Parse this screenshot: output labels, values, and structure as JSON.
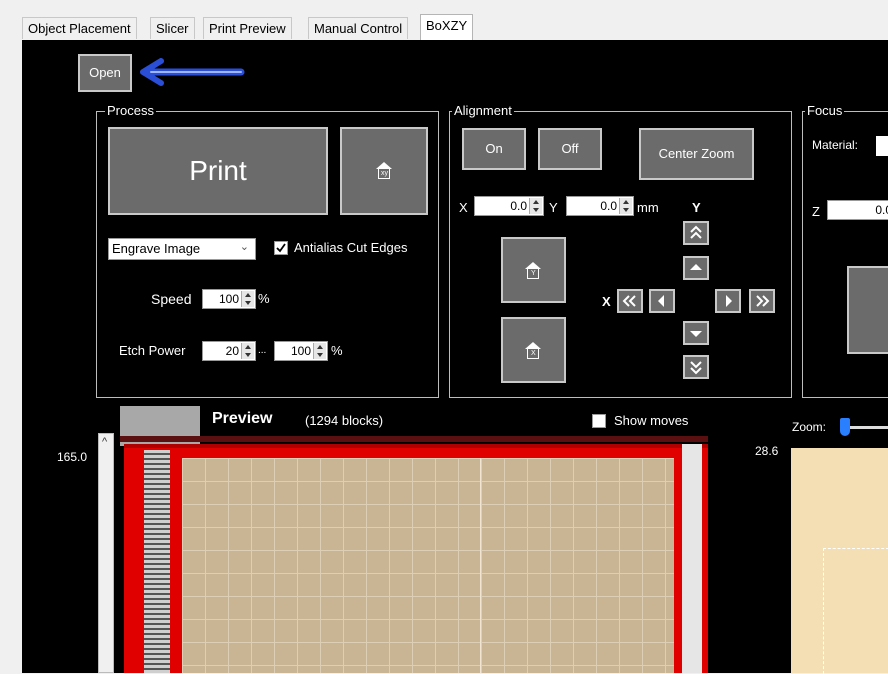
{
  "tabs": [
    {
      "label": "Object Placement"
    },
    {
      "label": "Slicer"
    },
    {
      "label": "Print Preview"
    },
    {
      "label": "Manual Control"
    },
    {
      "label": "BoXZY"
    }
  ],
  "open_button": "Open",
  "process": {
    "legend": "Process",
    "print_label": "Print",
    "home_icon_text": "xy",
    "mode_select": "Engrave Image",
    "antialias_label": "Antialias Cut Edges",
    "speed_label": "Speed",
    "speed_value": "100",
    "speed_unit": "%",
    "etch_label": "Etch Power",
    "etch_min": "20",
    "etch_sep": "...",
    "etch_max": "100",
    "etch_unit": "%"
  },
  "alignment": {
    "legend": "Alignment",
    "on_label": "On",
    "off_label": "Off",
    "center_zoom_label": "Center Zoom",
    "x_label": "X",
    "x_value": "0.0",
    "y_label": "Y",
    "y_value": "0.0",
    "unit": "mm",
    "jog_y_label": "Y",
    "jog_x_label": "X",
    "home_y_text": "Y",
    "home_x_text": "X"
  },
  "focus": {
    "legend": "Focus",
    "material_label": "Material:",
    "z_label": "Z",
    "z_value": "0.0"
  },
  "preview": {
    "title": "Preview",
    "blocks": "(1294 blocks)",
    "show_moves_label": "Show moves",
    "y_max": "165.0",
    "scroll_up": "^"
  },
  "zoom": {
    "label": "Zoom:",
    "value": "28.6"
  },
  "colors": {
    "accent_arrow": "#2a4fd6",
    "frame_red": "#e00000",
    "bed": "#c9b593",
    "zoom_bed": "#f4dfb5"
  }
}
